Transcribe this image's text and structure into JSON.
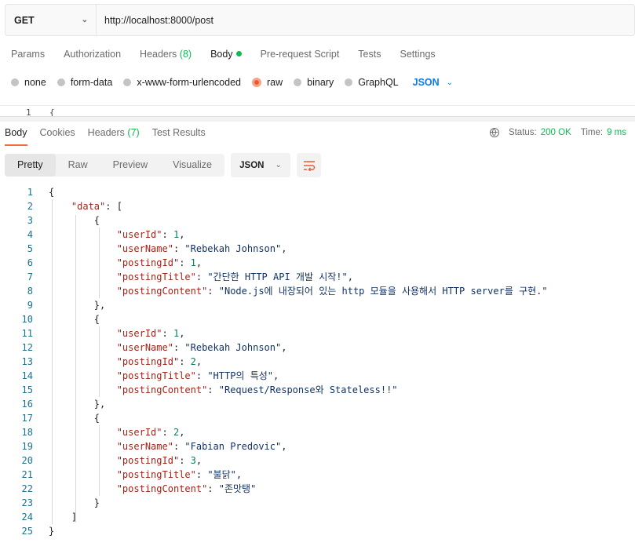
{
  "request": {
    "method": "GET",
    "url": "http://localhost:8000/post"
  },
  "request_tabs": [
    {
      "label": "Params"
    },
    {
      "label": "Authorization"
    },
    {
      "label": "Headers",
      "count": "(8)"
    },
    {
      "label": "Body"
    },
    {
      "label": "Pre-request Script"
    },
    {
      "label": "Tests"
    },
    {
      "label": "Settings"
    }
  ],
  "body_types": [
    {
      "label": "none"
    },
    {
      "label": "form-data"
    },
    {
      "label": "x-www-form-urlencoded"
    },
    {
      "label": "raw",
      "selected": true
    },
    {
      "label": "binary"
    },
    {
      "label": "GraphQL"
    }
  ],
  "body_format": "JSON",
  "request_editor": {
    "line_number": "1",
    "text": "{"
  },
  "response_tabs": [
    {
      "label": "Body"
    },
    {
      "label": "Cookies"
    },
    {
      "label": "Headers",
      "count": "(7)"
    },
    {
      "label": "Test Results"
    }
  ],
  "status": {
    "status_label": "Status:",
    "status_value": "200 OK",
    "time_label": "Time:",
    "time_value": "9 ms"
  },
  "view_modes": [
    "Pretty",
    "Raw",
    "Preview",
    "Visualize"
  ],
  "response_format": "JSON",
  "response_posts": [
    {
      "userId": "1",
      "userName": "\"Rebekah Johnson\"",
      "postingId": "1",
      "postingTitle": "\"간단한 HTTP API 개발 시작!\"",
      "postingContent": "\"Node.js에 내장되어 있는 http 모듈을 사용해서 HTTP server를 구현.\""
    },
    {
      "userId": "1",
      "userName": "\"Rebekah Johnson\"",
      "postingId": "2",
      "postingTitle": "\"HTTP의 특성\"",
      "postingContent": "\"Request/Response와 Stateless!!\""
    },
    {
      "userId": "2",
      "userName": "\"Fabian Predovic\"",
      "postingId": "3",
      "postingTitle": "\"불닭\"",
      "postingContent": "\"존맛탱\""
    }
  ],
  "colors": {
    "accent": "#f26b3a",
    "success": "#0cbb52",
    "link": "#097bed",
    "json_key": "#a0241a",
    "json_string": "#11305e",
    "json_number": "#0e7c63"
  }
}
